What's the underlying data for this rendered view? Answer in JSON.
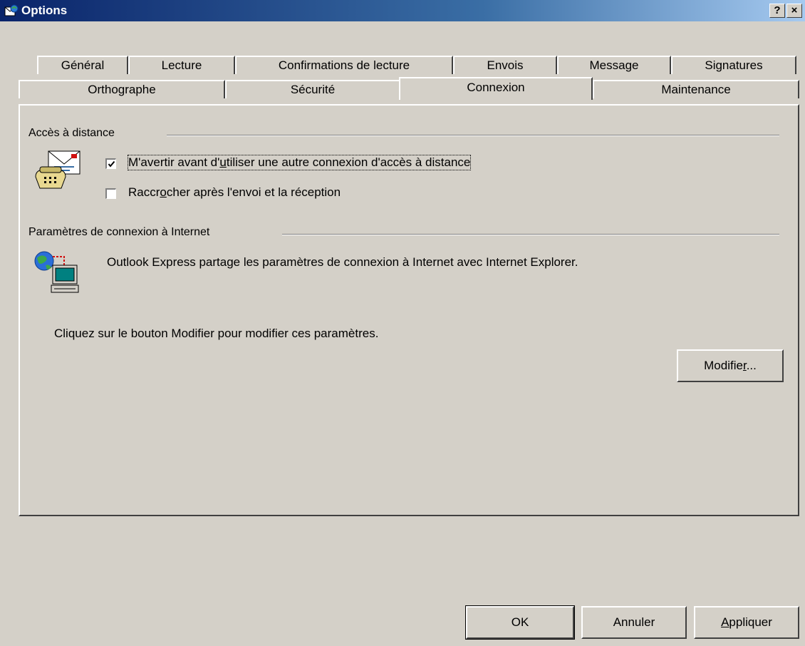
{
  "window": {
    "title": "Options",
    "help_label": "?",
    "close_label": "×"
  },
  "tabs_row1": [
    "Général",
    "Lecture",
    "Confirmations de lecture",
    "Envois",
    "Message",
    "Signatures"
  ],
  "tabs_row2": [
    "Orthographe",
    "Sécurité",
    "Connexion",
    "Maintenance"
  ],
  "active_tab": "Connexion",
  "dialup": {
    "group_label": "Accès à distance",
    "warn": {
      "pre": "M'avertir avant d'",
      "mnemonic": "u",
      "post": "tiliser une autre connexion d'accès à distance",
      "checked": true
    },
    "hangup": {
      "pre": "Raccr",
      "mnemonic": "o",
      "post": "cher après l'envoi et la réception",
      "checked": false
    }
  },
  "internet": {
    "group_label": "Paramètres de connexion à Internet",
    "description": "Outlook Express partage les paramètres de connexion à Internet avec Internet Explorer.",
    "hint": "Cliquez sur le bouton Modifier pour modifier ces paramètres.",
    "modify": {
      "pre": "Modifie",
      "mnemonic": "r",
      "post": "..."
    }
  },
  "footer": {
    "ok_label": "OK",
    "cancel_label": "Annuler",
    "apply": {
      "pre": "",
      "mnemonic": "A",
      "post": "ppliquer"
    }
  },
  "colors": {
    "face": "#d4d0c8",
    "title_start": "#0a246a",
    "title_end": "#a6caf0"
  }
}
